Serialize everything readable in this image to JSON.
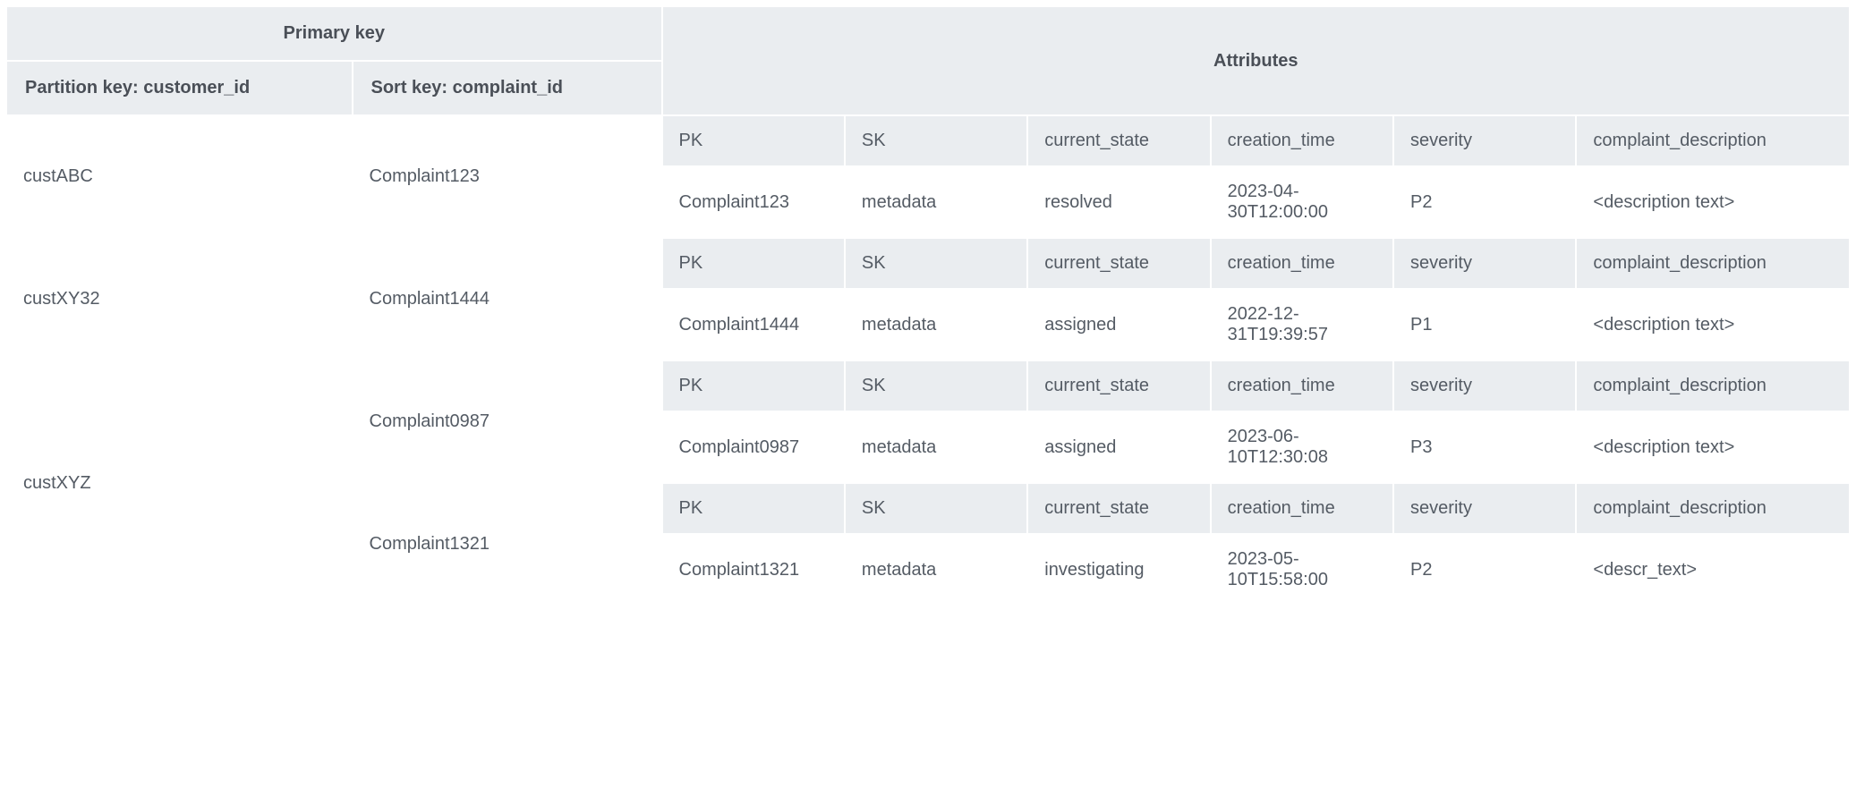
{
  "header": {
    "primary_key_label": "Primary key",
    "partition_key_label": "Partition key: customer_id",
    "sort_key_label": "Sort key: complaint_id",
    "attributes_label": "Attributes"
  },
  "attr_cols": [
    "PK",
    "SK",
    "current_state",
    "creation_time",
    "severity",
    "complaint_description"
  ],
  "rows": [
    {
      "partition": "custABC",
      "sort": "Complaint123",
      "values": {
        "PK": "Complaint123",
        "SK": "metadata",
        "current_state": "resolved",
        "creation_time": "2023-04-30T12:00:00",
        "severity": "P2",
        "complaint_description": "<description text>"
      }
    },
    {
      "partition": "custXY32",
      "sort": "Complaint1444",
      "values": {
        "PK": "Complaint1444",
        "SK": "metadata",
        "current_state": "assigned",
        "creation_time": "2022-12-31T19:39:57",
        "severity": "P1",
        "complaint_description": "<description text>"
      }
    },
    {
      "partition": "custXYZ",
      "sort": "Complaint0987",
      "values": {
        "PK": "Complaint0987",
        "SK": "metadata",
        "current_state": "assigned",
        "creation_time": "2023-06-10T12:30:08",
        "severity": "P3",
        "complaint_description": "<description text>"
      }
    },
    {
      "partition": "custXYZ",
      "sort": "Complaint1321",
      "values": {
        "PK": "Complaint1321",
        "SK": "metadata",
        "current_state": "investigating",
        "creation_time": "2023-05-10T15:58:00",
        "severity": "P2",
        "complaint_description": "<descr_text>"
      }
    }
  ]
}
